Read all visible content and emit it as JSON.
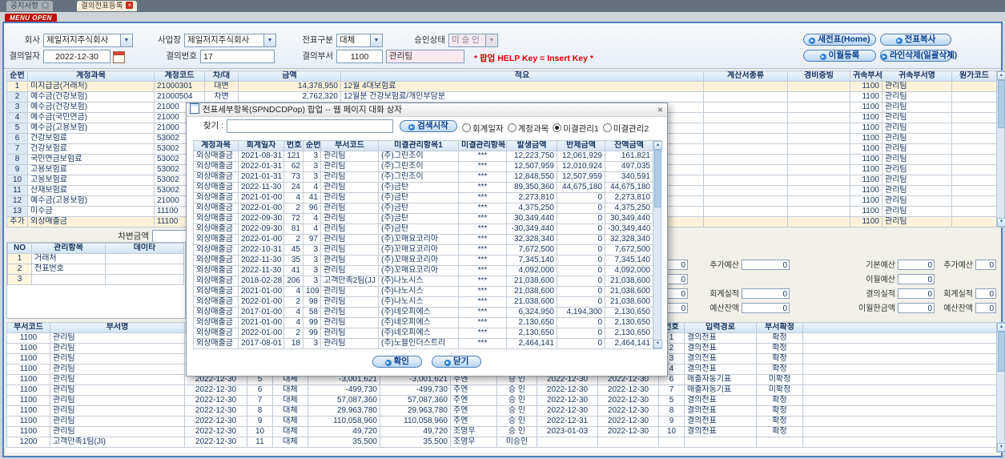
{
  "icons": {
    "close": "×",
    "dropdown": "▼",
    "up": "▲",
    "down": "▼",
    "bullet": "▶"
  },
  "tabs": [
    {
      "label": "공지사항"
    },
    {
      "label": "결의전표등록"
    }
  ],
  "menu_badge": "MENU OPEN",
  "form": {
    "company_label": "회사",
    "company": "제일저지주식회사",
    "bizplace_label": "사업장",
    "bizplace": "제일저지주식회사",
    "slip_type_label": "전표구분",
    "slip_type": "대체",
    "approval_label": "승인상태",
    "approval": "미 승 인",
    "date_label": "결의일자",
    "date": "2022-12-30",
    "slip_no_label": "결의번호",
    "slip_no": "17",
    "dept_label": "결의부서",
    "dept_code": "1100",
    "dept_name": "관리팀",
    "help_text": "* 팝업 HELP Key = Insert Key *",
    "btn_new": "새전표(Home)",
    "btn_copy": "전표복사",
    "btn_carryover": "이월등록",
    "btn_delete": "라인삭제(일괄삭제)"
  },
  "main_grid": {
    "headers": [
      "순번",
      "계정과목",
      "계정코드",
      "차/대",
      "금액",
      "적요",
      "계산서종류",
      "경비증빙",
      "귀속부서",
      "귀속부서명",
      "원가코드"
    ],
    "rows": [
      [
        "1",
        "미지급금(거래처)",
        "21000301",
        "대변",
        "14,378,950",
        "12월 4대보험료",
        "",
        "",
        "1100",
        "관리팀",
        ""
      ],
      [
        "2",
        "예수금(건강보험)",
        "21000504",
        "차변",
        "2,762,320",
        "12월분 건강보험료/개인부담분",
        "",
        "",
        "1100",
        "관리팀",
        ""
      ],
      [
        "3",
        "예수금(건강보험)",
        "21000",
        "",
        "",
        "",
        "",
        "",
        "1100",
        "관리팀",
        ""
      ],
      [
        "4",
        "예수금(국민연금)",
        "21000",
        "",
        "",
        "",
        "",
        "",
        "1100",
        "관리팀",
        ""
      ],
      [
        "5",
        "예수금(고용보험)",
        "21000",
        "",
        "",
        "",
        "",
        "",
        "1100",
        "관리팀",
        ""
      ],
      [
        "6",
        "건강보험료",
        "53002",
        "",
        "",
        "",
        "",
        "",
        "1100",
        "관리팀",
        ""
      ],
      [
        "7",
        "건강보험료",
        "53002",
        "",
        "",
        "",
        "",
        "",
        "1100",
        "관리팀",
        ""
      ],
      [
        "8",
        "국민연금보험료",
        "53002",
        "",
        "",
        "",
        "",
        "",
        "1100",
        "관리팀",
        ""
      ],
      [
        "9",
        "고용보험료",
        "53002",
        "",
        "",
        "",
        "",
        "",
        "1100",
        "관리팀",
        ""
      ],
      [
        "10",
        "고용보험료",
        "53002",
        "",
        "",
        "",
        "",
        "",
        "1100",
        "관리팀",
        ""
      ],
      [
        "11",
        "산재보험료",
        "53002",
        "",
        "",
        "",
        "",
        "",
        "1100",
        "관리팀",
        ""
      ],
      [
        "12",
        "예수금(고용보험)",
        "21000",
        "",
        "",
        "",
        "",
        "",
        "1100",
        "관리팀",
        ""
      ],
      [
        "13",
        "미수금",
        "11100",
        "",
        "",
        "",
        "",
        "",
        "1100",
        "관리팀",
        ""
      ],
      [
        "추가",
        "외상매출금",
        "11100",
        "",
        "",
        "",
        "",
        "",
        "1100",
        "관리팀",
        ""
      ]
    ]
  },
  "middle": {
    "debit_label": "차변금액",
    "mgmt_headers": [
      "NO",
      "관리항목",
      "데이타"
    ],
    "mgmt_rows": [
      [
        "1",
        "거래처",
        ""
      ],
      [
        "2",
        "전표번호",
        ""
      ],
      [
        "3",
        "",
        ""
      ]
    ]
  },
  "budget": {
    "panel_a": [
      [
        "기본예산",
        "0",
        "추가예산",
        "0"
      ],
      [
        "이월예산",
        "0",
        "",
        ""
      ],
      [
        "결의실적",
        "0",
        "회계실적",
        "0"
      ],
      [
        "이월한금액",
        "0",
        "예산잔액",
        "0"
      ]
    ],
    "panel_b": [
      [
        "기본예산",
        "0",
        "추가예산",
        "0"
      ],
      [
        "이월예산",
        "0",
        "",
        ""
      ],
      [
        "결의실적",
        "0",
        "회계실적",
        "0"
      ],
      [
        "이월한금액",
        "0",
        "예산잔액",
        "0"
      ]
    ]
  },
  "bottom_grid": {
    "headers": [
      "부서코드",
      "부서명",
      "",
      "",
      "",
      "",
      "",
      "",
      "",
      "",
      "",
      "번호",
      "입력경로",
      "부서확정",
      ""
    ],
    "rows": [
      [
        "1100",
        "관리팀",
        "",
        "",
        "",
        "",
        "",
        "",
        "",
        "",
        "",
        "1",
        "결의전표",
        "확정",
        ""
      ],
      [
        "1100",
        "관리팀",
        "",
        "",
        "",
        "",
        "",
        "",
        "",
        "",
        "",
        "2",
        "결의전표",
        "확정",
        ""
      ],
      [
        "1100",
        "관리팀",
        "",
        "",
        "",
        "",
        "",
        "",
        "",
        "",
        "",
        "3",
        "결의전표",
        "확정",
        ""
      ],
      [
        "1100",
        "관리팀",
        "",
        "",
        "",
        "",
        "",
        "",
        "",
        "",
        "",
        "4",
        "결의전표",
        "확정",
        ""
      ],
      [
        "1100",
        "관리팀",
        "2022-12-30",
        "5",
        "대체",
        "-3,001,621",
        "-3,001,621",
        "주엔",
        "승 인",
        "2022-12-30",
        "2022-12-30",
        "6",
        "매출자동기표",
        "미확정",
        ""
      ],
      [
        "1100",
        "관리팀",
        "2022-12-30",
        "6",
        "대체",
        "-499,730",
        "-499,730",
        "주엔",
        "승 인",
        "2022-12-30",
        "2022-12-30",
        "7",
        "매출자동기표",
        "미확정",
        ""
      ],
      [
        "1100",
        "관리팀",
        "2022-12-30",
        "7",
        "대체",
        "57,087,360",
        "57,087,360",
        "주엔",
        "승 인",
        "2022-12-30",
        "2022-12-30",
        "5",
        "결의전표",
        "확정",
        ""
      ],
      [
        "1100",
        "관리팀",
        "2022-12-30",
        "8",
        "대체",
        "29,963,780",
        "29,963,780",
        "주엔",
        "승 인",
        "2022-12-30",
        "2022-12-30",
        "8",
        "결의전표",
        "확정",
        ""
      ],
      [
        "1100",
        "관리팀",
        "2022-12-30",
        "9",
        "대체",
        "110,058,960",
        "110,058,960",
        "주엔",
        "승 인",
        "2022-12-31",
        "2022-12-30",
        "9",
        "결의전표",
        "확정",
        ""
      ],
      [
        "1100",
        "관리팀",
        "2022-12-30",
        "10",
        "대체",
        "49,720",
        "49,720",
        "조영우",
        "승 인",
        "2023-01-03",
        "2022-12-30",
        "10",
        "결의전표",
        "확정",
        ""
      ],
      [
        "1200",
        "고객만족1팀(JI)",
        "2022-12-30",
        "11",
        "대체",
        "35,500",
        "35,500",
        "조영우",
        "미승인",
        "",
        "",
        "",
        "",
        "",
        ""
      ]
    ]
  },
  "modal": {
    "title": "전표세부항목(SPNDCDPop) 팝업 -- 웹 페이지 대화 상자",
    "search_label": "찾기 :",
    "search_value": "",
    "search_button": "검색시작",
    "radios": [
      {
        "label": "회계일자",
        "checked": false
      },
      {
        "label": "계정과목",
        "checked": false
      },
      {
        "label": "미결관리1",
        "checked": true
      },
      {
        "label": "미결관리2",
        "checked": false
      }
    ],
    "grid_headers": [
      "계정과목",
      "회계일자",
      "번호",
      "순번",
      "부서코드",
      "미결관리항목1",
      "미결관리항목2",
      "발생금액",
      "반제금액",
      "잔액금액"
    ],
    "rows": [
      [
        "외상매출금",
        "2021-08-31",
        "121",
        "3",
        "관리팀",
        "(주)그린조이",
        "***",
        "12,223,750",
        "12,061,929",
        "161,821"
      ],
      [
        "외상매출금",
        "2022-01-31",
        "62",
        "3",
        "관리팀",
        "(주)그린조이",
        "***",
        "12,507,959",
        "12,010,924",
        "497,035"
      ],
      [
        "외상매출금",
        "2021-01-31",
        "73",
        "3",
        "관리팀",
        "(주)그린조이",
        "***",
        "12,848,550",
        "12,507,959",
        "340,591"
      ],
      [
        "외상매출금",
        "2022-11-30",
        "24",
        "4",
        "관리팀",
        "(주)금탄",
        "***",
        "89,350,360",
        "44,675,180",
        "44,675,180"
      ],
      [
        "외상매출금",
        "2021-01-00",
        "4",
        "41",
        "관리팀",
        "(주)금탄",
        "***",
        "2,273,810",
        "0",
        "2,273,810"
      ],
      [
        "외상매출금",
        "2022-01-00",
        "2",
        "96",
        "관리팀",
        "(주)금탄",
        "***",
        "4,375,250",
        "0",
        "4,375,250"
      ],
      [
        "외상매출금",
        "2022-09-30",
        "72",
        "4",
        "관리팀",
        "(주)금탄",
        "***",
        "30,349,440",
        "0",
        "30,349,440"
      ],
      [
        "외상매출금",
        "2022-09-30",
        "81",
        "4",
        "관리팀",
        "(주)금탄",
        "***",
        "-30,349,440",
        "0",
        "-30,349,440"
      ],
      [
        "외상매출금",
        "2022-01-00",
        "2",
        "97",
        "관리팀",
        "(주)꼬매요코리아",
        "***",
        "32,328,340",
        "0",
        "32,328,340"
      ],
      [
        "외상매출금",
        "2022-10-31",
        "45",
        "3",
        "관리팀",
        "(주)꼬매요코리아",
        "***",
        "7,672,500",
        "0",
        "7,672,500"
      ],
      [
        "외상매출금",
        "2022-11-30",
        "35",
        "3",
        "관리팀",
        "(주)꼬매요코리아",
        "***",
        "7,345,140",
        "0",
        "7,345,140"
      ],
      [
        "외상매출금",
        "2022-11-30",
        "41",
        "3",
        "관리팀",
        "(주)꼬매요코리아",
        "***",
        "4,092,000",
        "0",
        "4,092,000"
      ],
      [
        "외상매출금",
        "2018-02-28",
        "206",
        "3",
        "고객만족2팀(JJ",
        "(주)나노시스",
        "***",
        "21,038,600",
        "0",
        "21,038,600"
      ],
      [
        "외상매출금",
        "2021-01-00",
        "4",
        "109",
        "관리팀",
        "(주)나노시스",
        "***",
        "21,038,600",
        "0",
        "21,038,600"
      ],
      [
        "외상매출금",
        "2022-01-00",
        "2",
        "98",
        "관리팀",
        "(주)나노시스",
        "***",
        "21,038,600",
        "0",
        "21,038,600"
      ],
      [
        "외상매출금",
        "2017-01-00",
        "4",
        "58",
        "관리팀",
        "(주)네오피에스",
        "***",
        "6,324,950",
        "4,194,300",
        "2,130,650"
      ],
      [
        "외상매출금",
        "2021-01-00",
        "4",
        "99",
        "관리팀",
        "(주)네오피에스",
        "***",
        "2,130,650",
        "0",
        "2,130,650"
      ],
      [
        "외상매출금",
        "2022-01-00",
        "2",
        "99",
        "관리팀",
        "(주)네오피에스",
        "***",
        "2,130,650",
        "0",
        "2,130,650"
      ],
      [
        "외상매출금",
        "2017-08-01",
        "18",
        "3",
        "관리팀",
        "(주)노블인더스트리",
        "***",
        "2,464,141",
        "0",
        "2,464,141"
      ]
    ],
    "ok_button": "확인",
    "close_button": "닫기"
  }
}
